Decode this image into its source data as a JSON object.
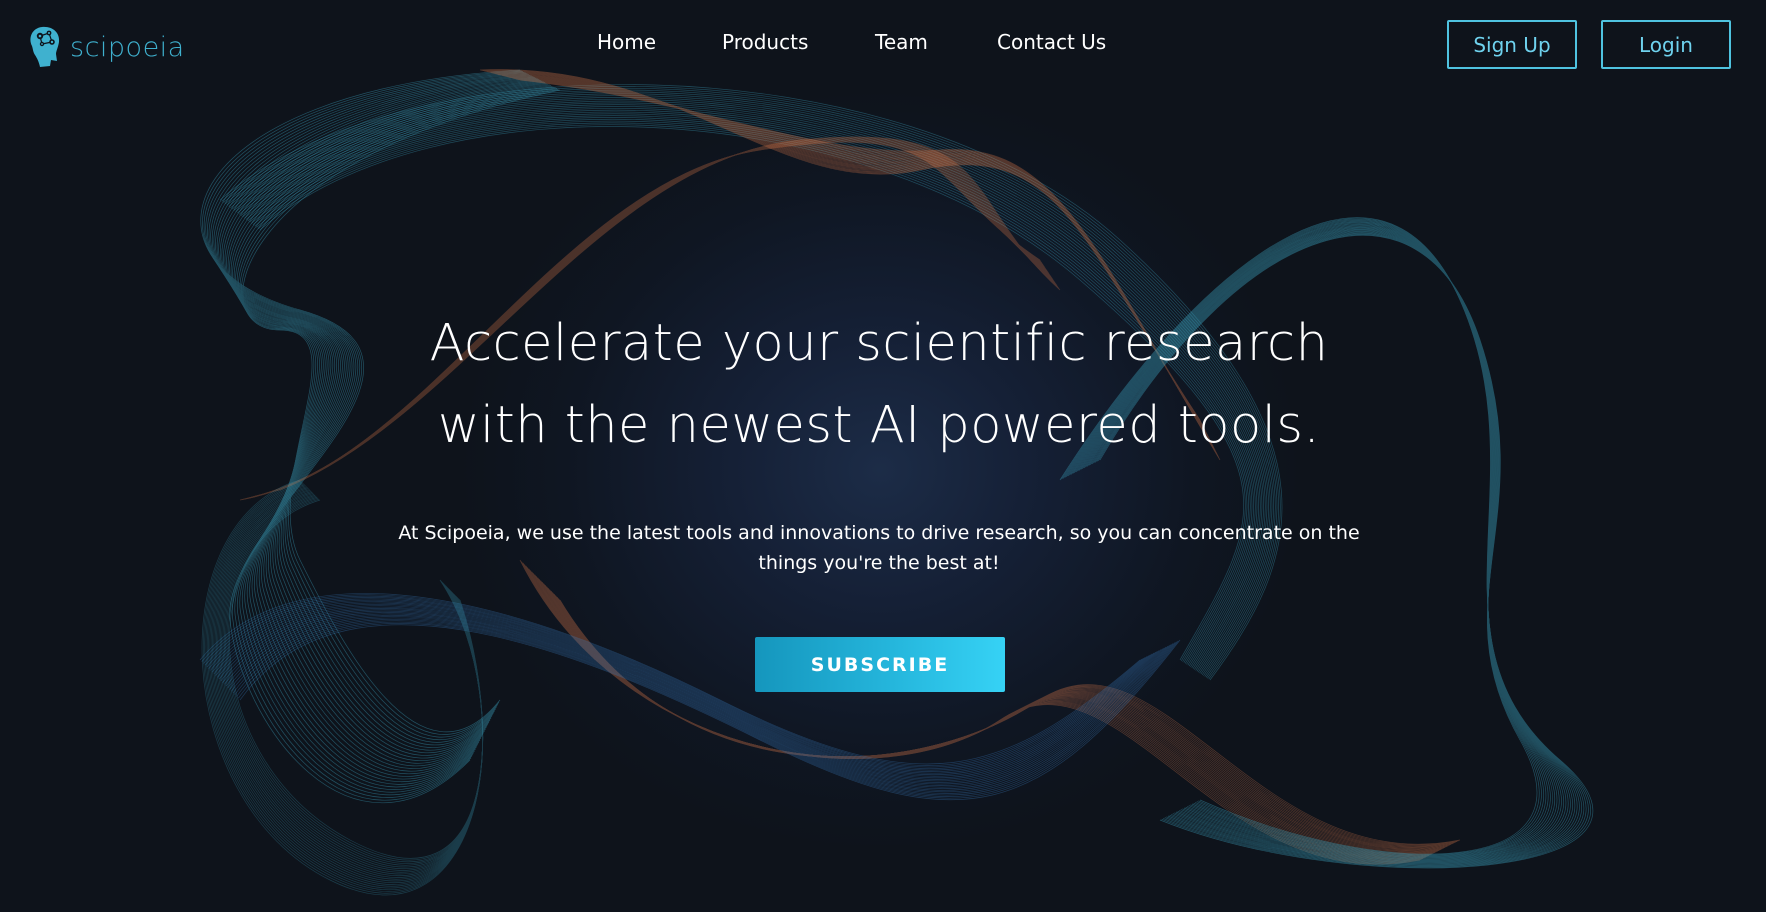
{
  "brand": {
    "name": "scipoeia",
    "accent_color": "#3fb1cf"
  },
  "nav": {
    "items": [
      {
        "label": "Home"
      },
      {
        "label": "Products"
      },
      {
        "label": "Team"
      },
      {
        "label": "Contact Us"
      }
    ]
  },
  "auth": {
    "signup_label": "Sign Up",
    "login_label": "Login",
    "border_color": "#4fc3e0"
  },
  "hero": {
    "title_line1": "Accelerate your scientific research",
    "title_line2": "with the newest AI powered tools.",
    "subtitle_line1": "At Scipoeia, we use the latest tools and innovations to drive research, so you can concentrate on the",
    "subtitle_line2": "things you're the best at!",
    "cta_label": "SUBSCRIBE"
  },
  "theme": {
    "background": "#0e131b",
    "line_teal": "#3a9db8",
    "line_orange": "#d9784a",
    "line_blue": "#3a7fc4"
  }
}
